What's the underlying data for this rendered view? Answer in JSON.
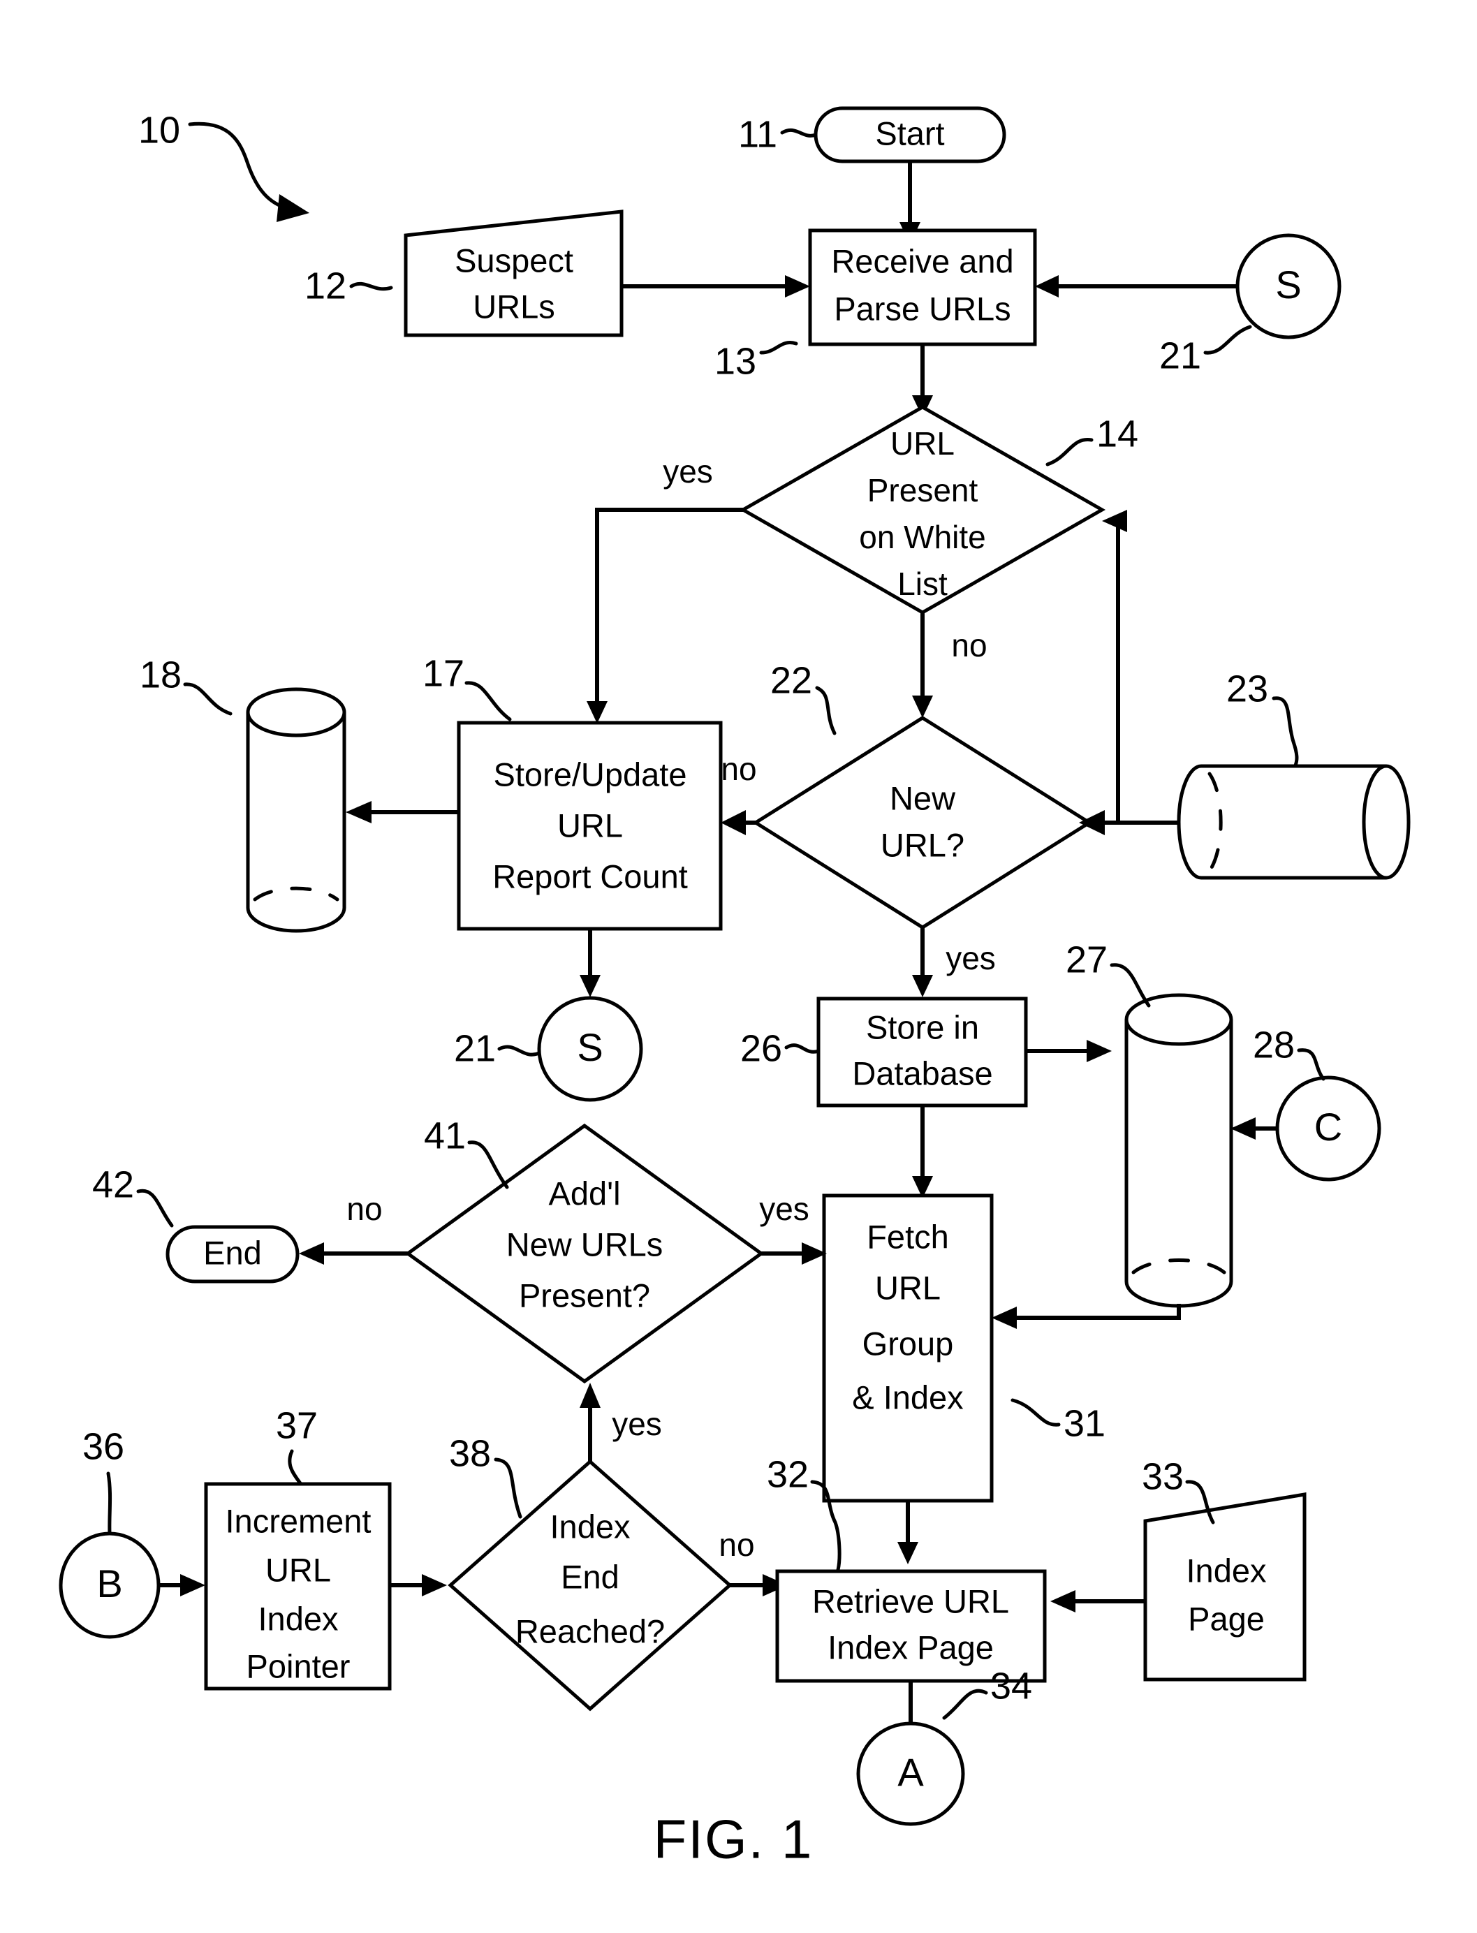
{
  "figure": {
    "caption": "FIG. 1",
    "diagram_ref": "10"
  },
  "nodes": {
    "start": {
      "label": "Start",
      "ref": "11",
      "shape": "stadium"
    },
    "suspect_urls": {
      "label_line1": "Suspect",
      "label_line2": "URLs",
      "ref": "12",
      "shape": "parallelogram-input"
    },
    "receive_parse": {
      "label_line1": "Receive and",
      "label_line2": "Parse URLs",
      "ref": "13",
      "shape": "process"
    },
    "connector_s_right": {
      "label": "S",
      "ref": "21",
      "shape": "circle-connector"
    },
    "white_list": {
      "label_line1": "URL",
      "label_line2": "Present",
      "label_line3": "on White",
      "label_line4": "List",
      "ref": "14",
      "shape": "decision"
    },
    "store_update": {
      "label_line1": "Store/Update",
      "label_line2": "URL",
      "label_line3": "Report Count",
      "ref": "17",
      "shape": "process"
    },
    "db_report": {
      "ref": "18",
      "shape": "cylinder-vertical"
    },
    "connector_s_left": {
      "label": "S",
      "ref": "21",
      "shape": "circle-connector"
    },
    "new_url": {
      "label_line1": "New",
      "label_line2": "URL?",
      "ref": "22",
      "shape": "decision"
    },
    "db_known": {
      "ref": "23",
      "shape": "cylinder-horizontal"
    },
    "store_database": {
      "label_line1": "Store in",
      "label_line2": "Database",
      "ref": "26",
      "shape": "process"
    },
    "db_crawl": {
      "ref": "27",
      "shape": "cylinder-vertical"
    },
    "connector_c": {
      "label": "C",
      "ref": "28",
      "shape": "circle-connector"
    },
    "addl_new_urls": {
      "label_line1": "Add'l",
      "label_line2": "New URLs",
      "label_line3": "Present?",
      "ref": "41",
      "shape": "decision"
    },
    "end": {
      "label": "End",
      "ref": "42",
      "shape": "stadium"
    },
    "fetch_url_group": {
      "label_line1": "Fetch",
      "label_line2": "URL",
      "label_line3": "Group",
      "label_line4": "& Index",
      "ref": "31",
      "shape": "process"
    },
    "connector_b": {
      "label": "B",
      "ref": "36",
      "shape": "circle-connector"
    },
    "increment_pointer": {
      "label_line1": "Increment",
      "label_line2": "URL",
      "label_line3": "Index",
      "label_line4": "Pointer",
      "ref": "37",
      "shape": "process"
    },
    "index_end": {
      "label_line1": "Index",
      "label_line2": "End",
      "label_line3": "Reached?",
      "ref": "38",
      "shape": "decision"
    },
    "retrieve_index_page": {
      "label_line1": "Retrieve URL",
      "label_line2": "Index Page",
      "ref": "32",
      "shape": "process"
    },
    "index_page": {
      "label_line1": "Index",
      "label_line2": "Page",
      "ref": "33",
      "shape": "parallelogram-input"
    },
    "connector_a": {
      "label": "A",
      "ref": "34",
      "shape": "circle-connector"
    }
  },
  "edge_labels": {
    "white_list_yes": "yes",
    "white_list_no": "no",
    "new_url_no": "no",
    "new_url_yes": "yes",
    "addl_no": "no",
    "addl_yes": "yes",
    "index_end_yes": "yes",
    "index_end_no": "no"
  },
  "colors": {
    "stroke": "#000000",
    "fill": "#ffffff"
  }
}
